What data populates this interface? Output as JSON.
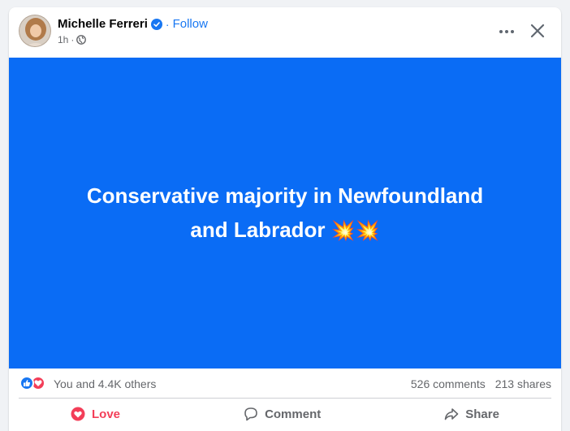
{
  "post": {
    "author": "Michelle Ferreri",
    "follow_label": "Follow",
    "separator": "·",
    "time": "1h",
    "meta_separator": "·",
    "text_line1": "Conservative majority in Newfoundland",
    "text_line2": "and Labrador",
    "emoji": "💥💥",
    "background_color": "#0a6cf5"
  },
  "reactions": {
    "summary": "You and 4.4K others",
    "comments": "526 comments",
    "shares": "213 shares"
  },
  "actions": {
    "love_label": "Love",
    "comment_label": "Comment",
    "share_label": "Share"
  },
  "icons": [
    "verified-badge-icon",
    "globe-icon",
    "more-options-icon",
    "close-icon",
    "like-reaction-icon",
    "love-reaction-icon",
    "heart-icon",
    "comment-icon",
    "share-icon"
  ],
  "colors": {
    "accent": "#1877f2",
    "love": "#f33e58",
    "muted_text": "#65676b"
  }
}
